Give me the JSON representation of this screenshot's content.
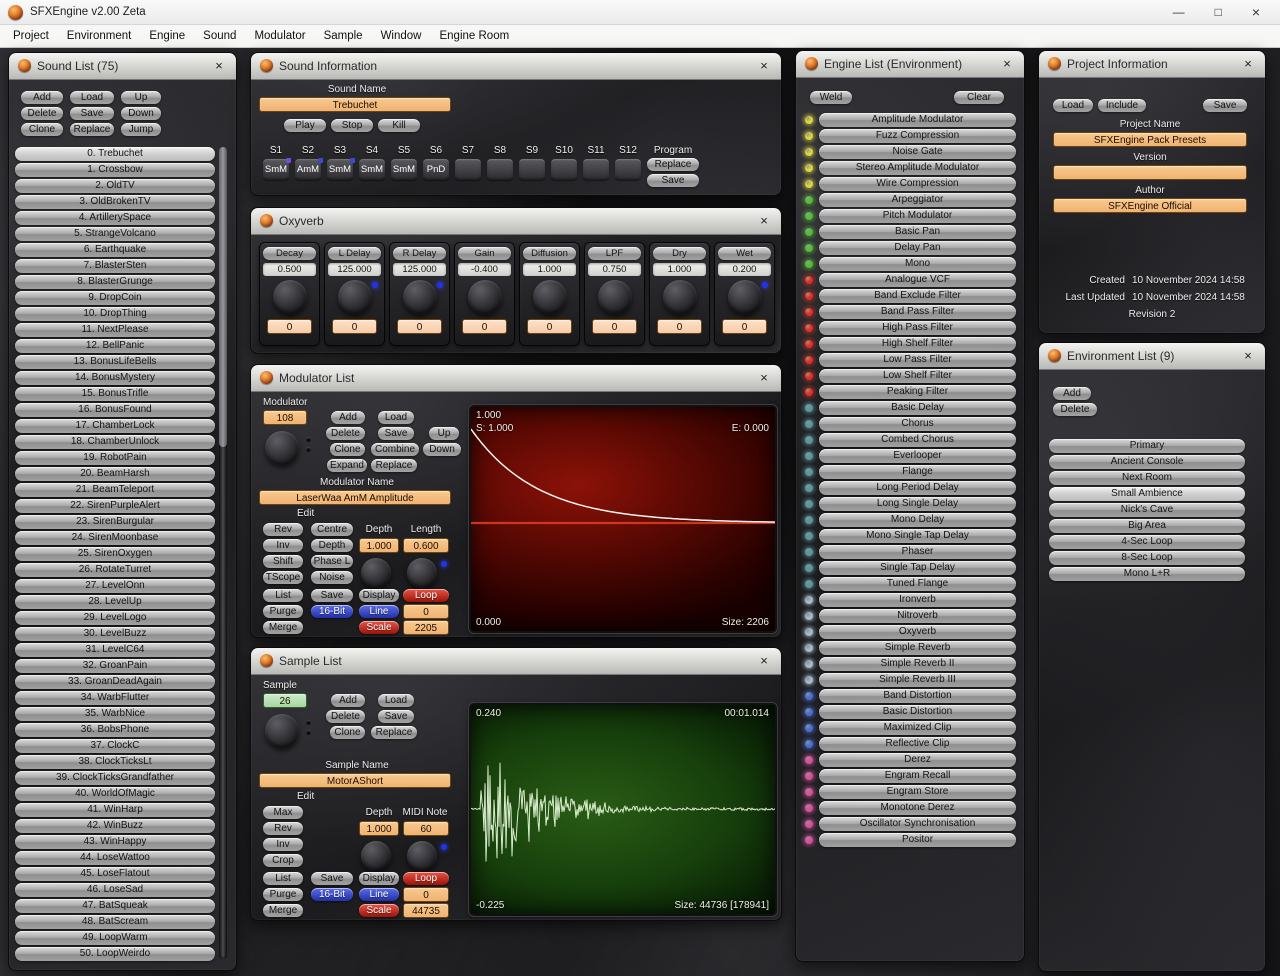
{
  "ui": {
    "close": "×",
    "minimize": "—",
    "maximize": "□"
  },
  "window": {
    "title": "SFXEngine v2.00 Zeta",
    "menu": [
      "Project",
      "Environment",
      "Engine",
      "Sound",
      "Modulator",
      "Sample",
      "Window",
      "Engine Room"
    ]
  },
  "sound_list": {
    "title": "Sound List (75)",
    "buttons": [
      [
        "Add",
        "Load",
        "Up"
      ],
      [
        "Delete",
        "Save",
        "Down"
      ],
      [
        "Clone",
        "Replace",
        "Jump"
      ]
    ],
    "selected_index": 0,
    "items": [
      "0. Trebuchet",
      "1. Crossbow",
      "2. OldTV",
      "3. OldBrokenTV",
      "4. ArtillerySpace",
      "5. StrangeVolcano",
      "6. Earthquake",
      "7. BlasterSten",
      "8. BlasterGrunge",
      "9. DropCoin",
      "10. DropThing",
      "11. NextPlease",
      "12. BellPanic",
      "13. BonusLifeBells",
      "14. BonusMystery",
      "15. BonusTrifle",
      "16. BonusFound",
      "17. ChamberLock",
      "18. ChamberUnlock",
      "19. RobotPain",
      "20. BeamHarsh",
      "21. BeamTeleport",
      "22. SirenPurpleAlert",
      "23. SirenBurgular",
      "24. SirenMoonbase",
      "25. SirenOxygen",
      "26. RotateTurret",
      "27. LevelOnn",
      "28. LevelUp",
      "29. LevelLogo",
      "30. LevelBuzz",
      "31. LevelC64",
      "32. GroanPain",
      "33. GroanDeadAgain",
      "34. WarbFlutter",
      "35. WarbNice",
      "36. BobsPhone",
      "37. ClockC",
      "38. ClockTicksLt",
      "39. ClockTicksGrandfather",
      "40. WorldOfMagic",
      "41. WinHarp",
      "42. WinBuzz",
      "43. WinHappy",
      "44. LoseWattoo",
      "45. LoseFlatout",
      "46. LoseSad",
      "47. BatSqueak",
      "48. BatScream",
      "49. LoopWarm",
      "50. LoopWeirdo"
    ]
  },
  "sound_info": {
    "title": "Sound Information",
    "name_label": "Sound Name",
    "name_value": "Trebuchet",
    "transport": [
      "Play",
      "Stop",
      "Kill"
    ],
    "slots": [
      {
        "label": "S1",
        "value": "SmM",
        "indicator": "#7b49d8"
      },
      {
        "label": "S2",
        "value": "AmM",
        "indicator": "#3b49d8"
      },
      {
        "label": "S3",
        "value": "SmM",
        "indicator": "#3b49d8"
      },
      {
        "label": "S4",
        "value": "SmM"
      },
      {
        "label": "S5",
        "value": "SmM"
      },
      {
        "label": "S6",
        "value": "PnD"
      },
      {
        "label": "S7",
        "value": ""
      },
      {
        "label": "S8",
        "value": ""
      },
      {
        "label": "S9",
        "value": ""
      },
      {
        "label": "S10",
        "value": ""
      },
      {
        "label": "S11",
        "value": ""
      },
      {
        "label": "S12",
        "value": ""
      }
    ],
    "program_label": "Program",
    "program_buttons": [
      "Replace",
      "Save"
    ]
  },
  "oxyverb": {
    "title": "Oxyverb",
    "modules": [
      {
        "label": "Decay",
        "value": "0.500",
        "field": "0",
        "dot": false
      },
      {
        "label": "L Delay",
        "value": "125.000",
        "field": "0",
        "dot": true
      },
      {
        "label": "R Delay",
        "value": "125.000",
        "field": "0",
        "dot": true
      },
      {
        "label": "Gain",
        "value": "-0.400",
        "field": "0",
        "dot": false
      },
      {
        "label": "Diffusion",
        "value": "1.000",
        "field": "0",
        "dot": false
      },
      {
        "label": "LPF",
        "value": "0.750",
        "field": "0",
        "dot": false
      },
      {
        "label": "Dry",
        "value": "1.000",
        "field": "0",
        "dot": false
      },
      {
        "label": "Wet",
        "value": "0.200",
        "field": "0",
        "dot": true
      }
    ]
  },
  "modulator": {
    "title": "Modulator List",
    "number_label": "Modulator",
    "number": "108",
    "btn_add": "Add",
    "btn_load": "Load",
    "btn_delete": "Delete",
    "btn_save": "Save",
    "btn_up": "Up",
    "btn_clone": "Clone",
    "btn_combine": "Combine",
    "btn_down": "Down",
    "btn_expand": "Expand",
    "btn_replace": "Replace",
    "name_label": "Modulator Name",
    "name_value": "LaserWaa AmM Amplitude",
    "edit_label": "Edit",
    "grid": {
      "rev": "Rev",
      "centre": "Centre",
      "depth_label": "Depth",
      "length_label": "Length",
      "inv": "Inv",
      "depth_btn": "Depth",
      "depth_value": "1.000",
      "length_value": "0.600",
      "shift": "Shift",
      "phase": "Phase L",
      "tscope": "TScope",
      "noise": "Noise",
      "list": "List",
      "save": "Save",
      "display": "Display",
      "loop": "Loop",
      "purge": "Purge",
      "bit": "16-Bit",
      "line": "Line",
      "loop_value": "0",
      "merge": "Merge",
      "scale": "Scale",
      "scale_value": "2205"
    },
    "display": {
      "scale_top": "1.000",
      "start": "S: 1.000",
      "end": "E: 0.000",
      "scale_bottom": "0.000",
      "size": "Size: 2206"
    }
  },
  "sample": {
    "title": "Sample List",
    "number_label": "Sample",
    "number": "26",
    "btn_add": "Add",
    "btn_load": "Load",
    "btn_delete": "Delete",
    "btn_save": "Save",
    "btn_clone": "Clone",
    "btn_replace": "Replace",
    "name_label": "Sample Name",
    "name_value": "MotorAShort",
    "edit_label": "Edit",
    "grid": {
      "max": "Max",
      "rev": "Rev",
      "inv": "Inv",
      "crop": "Crop",
      "depth_label": "Depth",
      "midi_label": "MIDI Note",
      "depth_value": "1.000",
      "midi_value": "60",
      "list": "List",
      "save": "Save",
      "display": "Display",
      "loop": "Loop",
      "purge": "Purge",
      "bit": "16-Bit",
      "line": "Line",
      "loop_value": "0",
      "merge": "Merge",
      "scale": "Scale",
      "scale_value": "44735"
    },
    "display": {
      "top_left": "0.240",
      "top_right": "00:01.014",
      "bottom_left": "-0.225",
      "bottom_right": "Size: 44736 [178941]"
    }
  },
  "engine_list": {
    "title": "Engine List (Environment)",
    "weld": "Weld",
    "clear": "Clear",
    "led_colors": {
      "yellow": "#d9d640",
      "green": "#55bb35",
      "red": "#d93226",
      "teal": "#56989b",
      "slate": "#a4bccb",
      "blue": "#4a6ed0",
      "magenta": "#d94f9b"
    },
    "items": [
      {
        "label": "Amplitude Modulator",
        "led": "yellow"
      },
      {
        "label": "Fuzz Compression",
        "led": "yellow"
      },
      {
        "label": "Noise Gate",
        "led": "yellow"
      },
      {
        "label": "Stereo Amplitude Modulator",
        "led": "yellow"
      },
      {
        "label": "Wire Compression",
        "led": "yellow"
      },
      {
        "label": "Arpeggiator",
        "led": "green"
      },
      {
        "label": "Pitch Modulator",
        "led": "green"
      },
      {
        "label": "Basic Pan",
        "led": "green"
      },
      {
        "label": "Delay Pan",
        "led": "green"
      },
      {
        "label": "Mono",
        "led": "green"
      },
      {
        "label": "Analogue VCF",
        "led": "red"
      },
      {
        "label": "Band Exclude Filter",
        "led": "red"
      },
      {
        "label": "Band Pass Filter",
        "led": "red"
      },
      {
        "label": "High Pass Filter",
        "led": "red"
      },
      {
        "label": "High Shelf Filter",
        "led": "red"
      },
      {
        "label": "Low Pass Filter",
        "led": "red"
      },
      {
        "label": "Low Shelf Filter",
        "led": "red"
      },
      {
        "label": "Peaking Filter",
        "led": "red"
      },
      {
        "label": "Basic Delay",
        "led": "teal"
      },
      {
        "label": "Chorus",
        "led": "teal"
      },
      {
        "label": "Combed Chorus",
        "led": "teal"
      },
      {
        "label": "Everlooper",
        "led": "teal"
      },
      {
        "label": "Flange",
        "led": "teal"
      },
      {
        "label": "Long Period Delay",
        "led": "teal"
      },
      {
        "label": "Long Single Delay",
        "led": "teal"
      },
      {
        "label": "Mono Delay",
        "led": "teal"
      },
      {
        "label": "Mono Single Tap Delay",
        "led": "teal"
      },
      {
        "label": "Phaser",
        "led": "teal"
      },
      {
        "label": "Single Tap Delay",
        "led": "teal"
      },
      {
        "label": "Tuned Flange",
        "led": "teal"
      },
      {
        "label": "Ironverb",
        "led": "slate"
      },
      {
        "label": "Nitroverb",
        "led": "slate"
      },
      {
        "label": "Oxyverb",
        "led": "slate"
      },
      {
        "label": "Simple Reverb",
        "led": "slate"
      },
      {
        "label": "Simple Reverb II",
        "led": "slate"
      },
      {
        "label": "Simple Reverb III",
        "led": "slate"
      },
      {
        "label": "Band Distortion",
        "led": "blue"
      },
      {
        "label": "Basic Distortion",
        "led": "blue"
      },
      {
        "label": "Maximized Clip",
        "led": "blue"
      },
      {
        "label": "Reflective Clip",
        "led": "blue"
      },
      {
        "label": "Derez",
        "led": "magenta"
      },
      {
        "label": "Engram Recall",
        "led": "magenta"
      },
      {
        "label": "Engram Store",
        "led": "magenta"
      },
      {
        "label": "Monotone Derez",
        "led": "magenta"
      },
      {
        "label": "Oscillator Synchronisation",
        "led": "magenta"
      },
      {
        "label": "Positor",
        "led": "magenta"
      }
    ]
  },
  "project_info": {
    "title": "Project Information",
    "buttons": [
      "Load",
      "Include",
      "Save"
    ],
    "name_label": "Project Name",
    "name_value": "SFXEngine Pack Presets",
    "version_label": "Version",
    "version_value": "",
    "author_label": "Author",
    "author_value": "SFXEngine Official",
    "created_label": "Created",
    "created_value": "10 November 2024 14:58",
    "updated_label": "Last Updated",
    "updated_value": "10 November 2024 14:58",
    "revision": "Revision 2"
  },
  "environment_list": {
    "title": "Environment List (9)",
    "buttons": [
      "Add",
      "Delete"
    ],
    "selected_index": 3,
    "items": [
      "Primary",
      "Ancient Console",
      "Next Room",
      "Small Ambience",
      "Nick's Cave",
      "Big Area",
      "4-Sec Loop",
      "8-Sec Loop",
      "Mono L+R"
    ]
  }
}
